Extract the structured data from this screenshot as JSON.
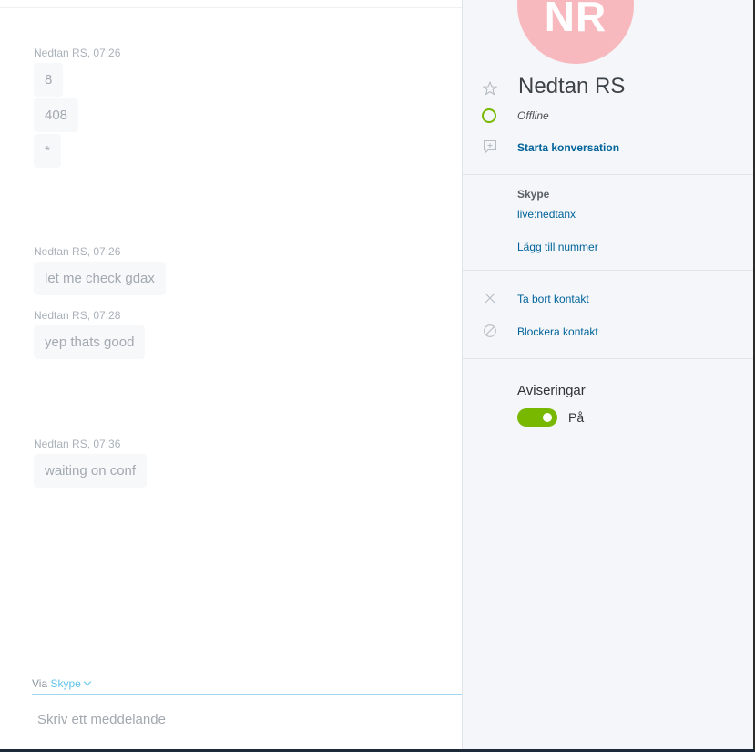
{
  "chat": {
    "groups": [
      {
        "sender": "Nedtan RS, 07:26",
        "messages": [
          "8",
          "408",
          "*"
        ]
      },
      {
        "sender": "Nedtan RS, 07:26",
        "messages": [
          "let me check gdax"
        ]
      },
      {
        "sender": "Nedtan RS, 07:28",
        "messages": [
          "yep thats good"
        ]
      },
      {
        "sender": "Nedtan RS, 07:36",
        "messages": [
          "waiting on conf"
        ]
      }
    ],
    "via_label": "Via",
    "via_service": "Skype",
    "compose_placeholder": "Skriv ett meddelande"
  },
  "profile": {
    "initials": "NR",
    "name": "Nedtan RS",
    "status": "Offline",
    "start_conversation": "Starta konversation",
    "skype_label": "Skype",
    "skype_id": "live:nedtanx",
    "add_number": "Lägg till nummer",
    "remove_contact": "Ta bort kontakt",
    "block_contact": "Blockera kontakt",
    "notifications_title": "Aviseringar",
    "notifications_state": "På",
    "notifications_on": true
  },
  "colors": {
    "accent_link": "#00639a",
    "presence_offline_ring": "#78b800",
    "toggle_on": "#78b800",
    "avatar_bg": "#f8b9be",
    "via_link": "#5fc2ec"
  },
  "icons": {
    "favorite": "star-icon",
    "presence": "status-ring-icon",
    "start_conversation": "new-chat-icon",
    "remove": "close-icon",
    "block": "block-icon",
    "dropdown": "chevron-down-icon"
  }
}
